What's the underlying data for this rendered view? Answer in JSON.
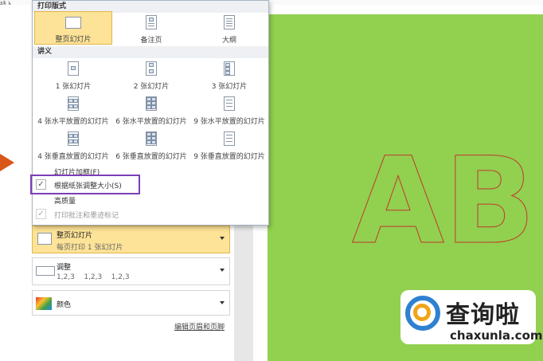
{
  "ribbon": {
    "left_label": "插入"
  },
  "popup": {
    "print_layout_header": "打印版式",
    "layouts": [
      {
        "label": "整页幻灯片",
        "selected": true
      },
      {
        "label": "备注页",
        "selected": false
      },
      {
        "label": "大纲",
        "selected": false
      }
    ],
    "handouts_header": "讲义",
    "handouts": [
      "1 张幻灯片",
      "2 张幻灯片",
      "3 张幻灯片",
      "4 张水平放置的幻灯片",
      "6 张水平放置的幻灯片",
      "9 张水平放置的幻灯片",
      "4 张垂直放置的幻灯片",
      "6 张垂直放置的幻灯片",
      "9 张垂直放置的幻灯片"
    ],
    "options": [
      {
        "label": "幻灯片加框(F)",
        "checked": false
      },
      {
        "label": "根据纸张调整大小(S)",
        "checked": true
      },
      {
        "label": "高质量",
        "checked": false
      },
      {
        "label": "打印批注和墨迹标记",
        "checked": true,
        "disabled": true
      }
    ]
  },
  "settings": {
    "layout_dropdown": {
      "title": "整页幻灯片",
      "subtitle": "每页打印 1 张幻灯片"
    },
    "collate_dropdown": {
      "title": "调整",
      "subtitle": "1,2,3    1,2,3    1,2,3"
    },
    "color_dropdown": {
      "title": "颜色"
    },
    "edit_header_footer": "编辑页眉和页脚"
  },
  "slide": {
    "text": "AB",
    "background": "#92d050",
    "outline_color": "#c0392b"
  },
  "watermark": {
    "title": "查询啦",
    "url": "chaxunla.com"
  },
  "colors": {
    "accent_selected": "#fde397",
    "highlight_box": "#7b3fb7",
    "nav_marker": "#d9571a"
  }
}
